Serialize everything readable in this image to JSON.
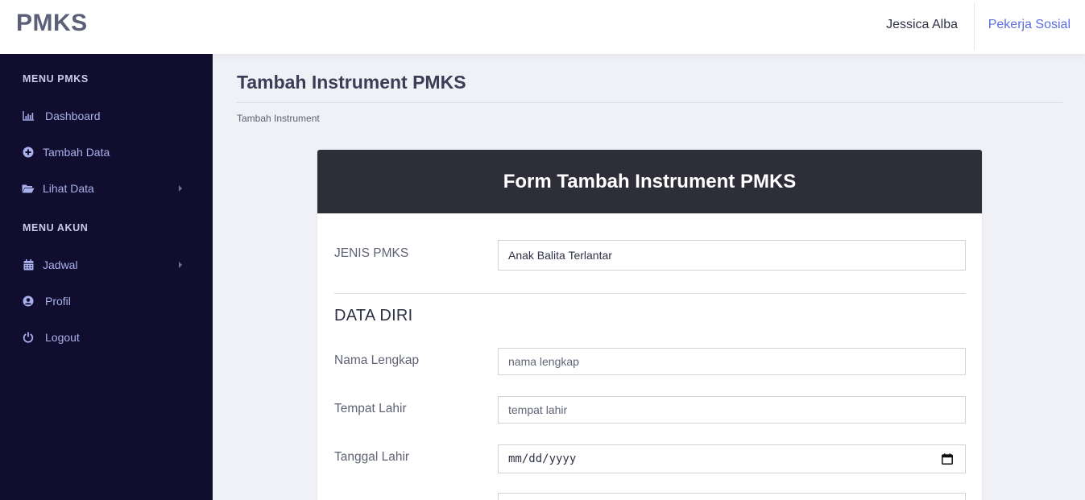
{
  "header": {
    "brand": "PMKS",
    "user_name": "Jessica Alba",
    "role": "Pekerja Sosial"
  },
  "sidebar": {
    "sections": [
      {
        "title": "MENU PMKS",
        "items": [
          {
            "label": "Dashboard",
            "icon": "bar-chart-icon",
            "has_submenu": false
          },
          {
            "label": "Tambah Data",
            "icon": "plus-circle-icon",
            "has_submenu": false
          },
          {
            "label": "Lihat Data",
            "icon": "folder-open-icon",
            "has_submenu": true
          }
        ]
      },
      {
        "title": "MENU AKUN",
        "items": [
          {
            "label": "Jadwal",
            "icon": "calendar-icon",
            "has_submenu": true
          },
          {
            "label": "Profil",
            "icon": "user-circle-icon",
            "has_submenu": false
          },
          {
            "label": "Logout",
            "icon": "power-icon",
            "has_submenu": false
          }
        ]
      }
    ]
  },
  "page": {
    "title": "Tambah Instrument PMKS",
    "breadcrumb": "Tambah Instrument"
  },
  "form": {
    "title": "Form Tambah Instrument PMKS",
    "jenis_pmks": {
      "label": "JENIS PMKS",
      "value": "Anak Balita Terlantar"
    },
    "section_title": "DATA DIRI",
    "nama_lengkap": {
      "label": "Nama Lengkap",
      "placeholder": "nama lengkap"
    },
    "tempat_lahir": {
      "label": "Tempat Lahir",
      "placeholder": "tempat lahir"
    },
    "tanggal_lahir": {
      "label": "Tanggal Lahir",
      "placeholder": "mm/dd/yyyy"
    }
  }
}
